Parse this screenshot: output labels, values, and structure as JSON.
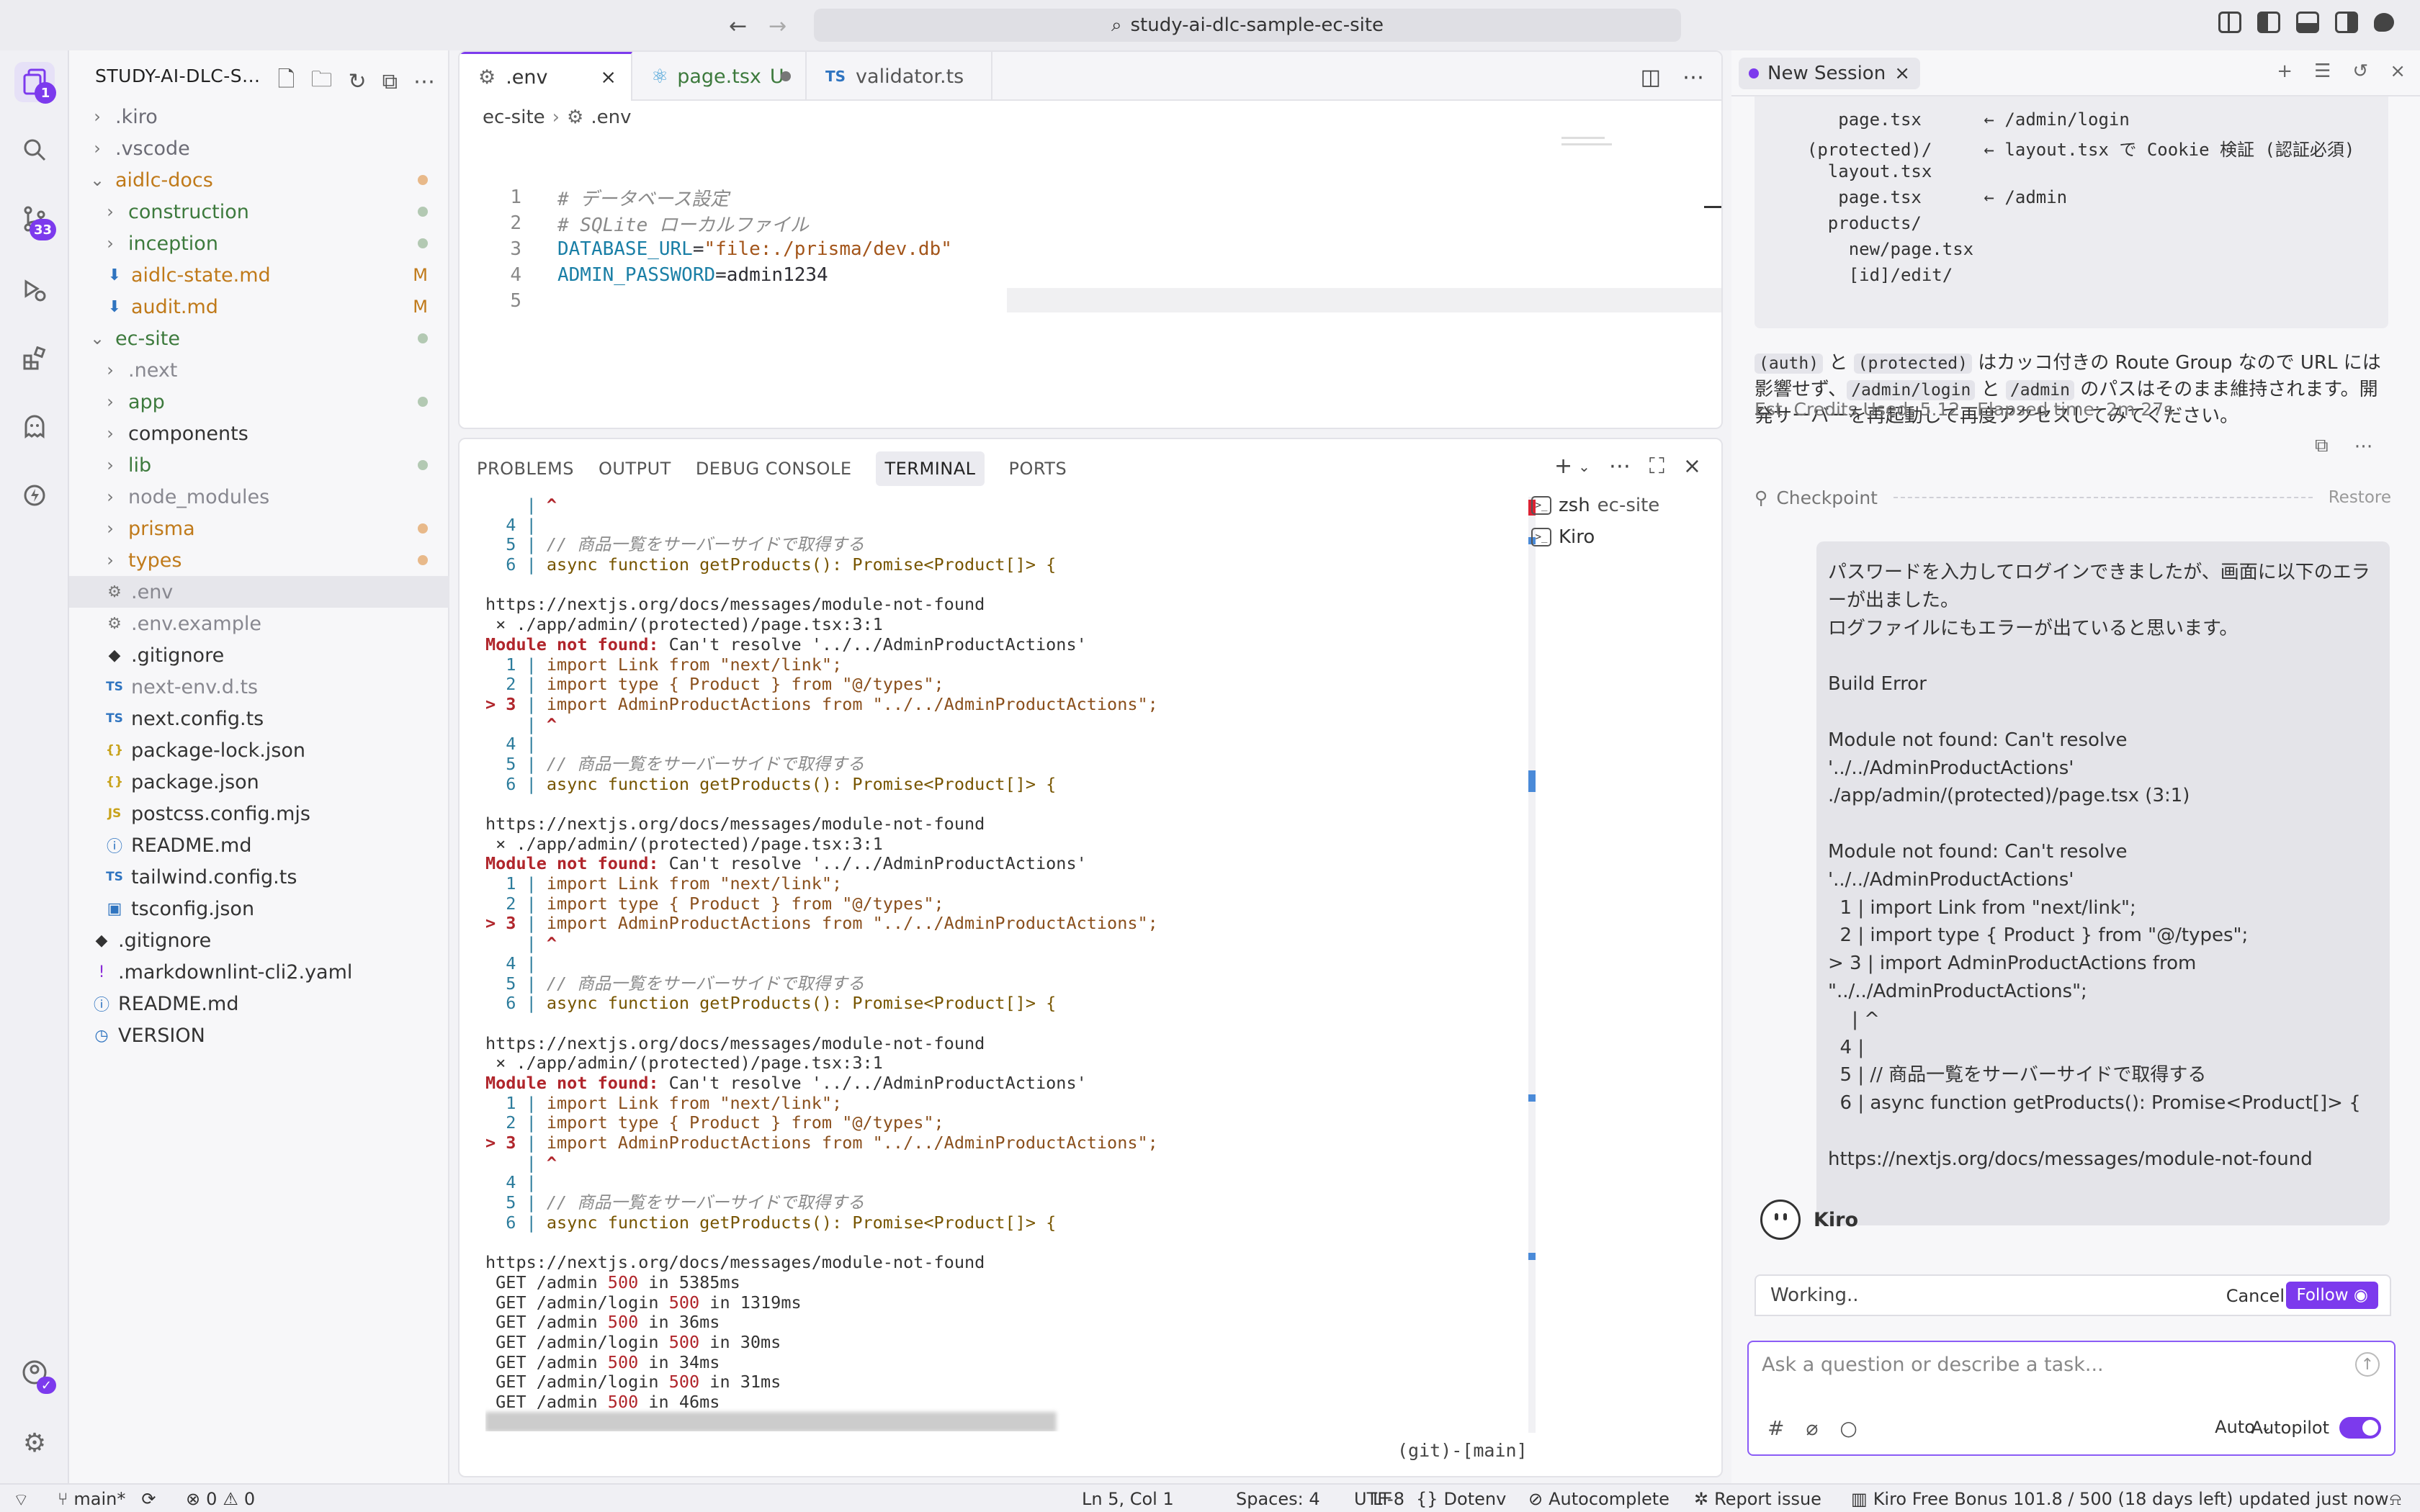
{
  "window": {
    "search": "study-ai-dlc-sample-ec-site"
  },
  "activity": {
    "explorer_badge": "1",
    "scm_badge": "33"
  },
  "explorer": {
    "title": "STUDY-AI-DLC-S...",
    "items": [
      {
        "label": ".kiro",
        "type": "folder",
        "depth": 0,
        "color": "#6b6b75"
      },
      {
        "label": ".vscode",
        "type": "folder",
        "depth": 0,
        "color": "#6b6b75"
      },
      {
        "label": "aidlc-docs",
        "type": "folder-open",
        "depth": 0,
        "color": "#c07a1a",
        "dot": "#e8b98a"
      },
      {
        "label": "construction",
        "type": "folder",
        "depth": 1,
        "color": "#3d7a3d",
        "dot": "#b3c9b3"
      },
      {
        "label": "inception",
        "type": "folder",
        "depth": 1,
        "color": "#3d7a3d",
        "dot": "#b3c9b3"
      },
      {
        "label": "aidlc-state.md",
        "type": "md",
        "depth": 1,
        "color": "#c07a1a",
        "mark": "M"
      },
      {
        "label": "audit.md",
        "type": "md",
        "depth": 1,
        "color": "#c07a1a",
        "mark": "M"
      },
      {
        "label": "ec-site",
        "type": "folder-open",
        "depth": 0,
        "color": "#3d7a3d",
        "dot": "#b3c9b3"
      },
      {
        "label": ".next",
        "type": "folder",
        "depth": 1,
        "color": "#888890"
      },
      {
        "label": "app",
        "type": "folder",
        "depth": 1,
        "color": "#3d7a3d",
        "dot": "#b3c9b3"
      },
      {
        "label": "components",
        "type": "folder",
        "depth": 1,
        "color": "#333"
      },
      {
        "label": "lib",
        "type": "folder",
        "depth": 1,
        "color": "#3d7a3d",
        "dot": "#b3c9b3"
      },
      {
        "label": "node_modules",
        "type": "folder",
        "depth": 1,
        "color": "#888890"
      },
      {
        "label": "prisma",
        "type": "folder",
        "depth": 1,
        "color": "#c07a1a",
        "dot": "#e8b98a"
      },
      {
        "label": "types",
        "type": "folder",
        "depth": 1,
        "color": "#c07a1a",
        "dot": "#e8b98a"
      },
      {
        "label": ".env",
        "type": "gear",
        "depth": 1,
        "color": "#888890",
        "selected": true
      },
      {
        "label": ".env.example",
        "type": "gear",
        "depth": 1,
        "color": "#888890"
      },
      {
        "label": ".gitignore",
        "type": "git",
        "depth": 1,
        "color": "#333"
      },
      {
        "label": "next-env.d.ts",
        "type": "ts",
        "depth": 1,
        "color": "#888890"
      },
      {
        "label": "next.config.ts",
        "type": "ts",
        "depth": 1,
        "color": "#333"
      },
      {
        "label": "package-lock.json",
        "type": "json",
        "depth": 1,
        "color": "#333"
      },
      {
        "label": "package.json",
        "type": "json",
        "depth": 1,
        "color": "#333"
      },
      {
        "label": "postcss.config.mjs",
        "type": "js",
        "depth": 1,
        "color": "#333"
      },
      {
        "label": "README.md",
        "type": "info",
        "depth": 1,
        "color": "#333"
      },
      {
        "label": "tailwind.config.ts",
        "type": "ts",
        "depth": 1,
        "color": "#333"
      },
      {
        "label": "tsconfig.json",
        "type": "tsj",
        "depth": 1,
        "color": "#333"
      },
      {
        "label": ".gitignore",
        "type": "git",
        "depth": 0,
        "color": "#333"
      },
      {
        "label": ".markdownlint-cli2.yaml",
        "type": "yaml",
        "depth": 0,
        "color": "#333"
      },
      {
        "label": "README.md",
        "type": "info",
        "depth": 0,
        "color": "#333"
      },
      {
        "label": "VERSION",
        "type": "clock",
        "depth": 0,
        "color": "#333"
      }
    ]
  },
  "editor": {
    "tabs": [
      {
        "label": ".env",
        "icon": "gear",
        "active": true,
        "suffix": "×"
      },
      {
        "label": "page.tsx",
        "icon": "react",
        "active": false,
        "suffix": "U"
      },
      {
        "label": "validator.ts",
        "icon": "ts",
        "active": false,
        "suffix": ""
      }
    ],
    "breadcrumb": {
      "folder": "ec-site",
      "file": ".env"
    },
    "lines": [
      {
        "n": "1",
        "parts": [
          {
            "t": "# データベース設定",
            "c": "comment"
          }
        ]
      },
      {
        "n": "2",
        "parts": [
          {
            "t": "# SQLite ローカルファイル",
            "c": "comment"
          }
        ]
      },
      {
        "n": "3",
        "parts": [
          {
            "t": "DATABASE_URL",
            "c": "key"
          },
          {
            "t": "=",
            "c": ""
          },
          {
            "t": "\"file:./prisma/dev.db\"",
            "c": "str"
          }
        ]
      },
      {
        "n": "4",
        "parts": [
          {
            "t": "ADMIN_PASSWORD",
            "c": "key"
          },
          {
            "t": "=admin1234",
            "c": ""
          }
        ]
      },
      {
        "n": "5",
        "parts": []
      }
    ]
  },
  "panel": {
    "tabs": [
      "PROBLEMS",
      "OUTPUT",
      "DEBUG CONSOLE",
      "TERMINAL",
      "PORTS"
    ],
    "active_tab": "TERMINAL",
    "terminals": [
      {
        "name": "zsh",
        "cwd": "ec-site"
      },
      {
        "name": "Kiro",
        "cwd": ""
      }
    ],
    "prompt_right": "(git)-[main]",
    "url": "https://nextjs.org/docs/messages/module-not-found",
    "file": " × ./app/admin/(protected)/page.tsx:3:1",
    "err_label": "Module not found:",
    "err_msg": " Can't resolve '../../AdminProductActions'",
    "import1": "import Link from \"next/link\";",
    "import2": "import type { Product } from \"@/types\";",
    "import3": "import AdminProductActions from \"../../AdminProductActions\";",
    "comment": "// 商品一覧をサーバーサイドで取得する",
    "fn": "async function getProducts(): Promise<Product[]> {",
    "caret": "^",
    "requests": [
      {
        "path": "/admin",
        "status": "500",
        "time": "in 5385ms"
      },
      {
        "path": "/admin/login",
        "status": "500",
        "time": "in 1319ms"
      },
      {
        "path": "/admin",
        "status": "500",
        "time": "in 36ms"
      },
      {
        "path": "/admin/login",
        "status": "500",
        "time": "in 30ms"
      },
      {
        "path": "/admin",
        "status": "500",
        "time": "in 34ms"
      },
      {
        "path": "/admin/login",
        "status": "500",
        "time": "in 31ms"
      },
      {
        "path": "/admin",
        "status": "500",
        "time": "in 46ms"
      }
    ]
  },
  "chat": {
    "session_tab": "New Session",
    "tree": [
      {
        "text": "     page.tsx      ← /admin/login",
        "kw": ""
      },
      {
        "text": "  (protected)/     ← layout.tsx で Cookie 検証 (認証必須)",
        "kw": ""
      },
      {
        "text": "    layout.tsx",
        "kw": ""
      },
      {
        "text": "     page.tsx      ← /admin",
        "kw": ""
      },
      {
        "text": "    products/",
        "kw": ""
      },
      {
        "text": "      new/page.tsx",
        "kw": ""
      },
      {
        "text": "      [id]/edit/",
        "kw": ""
      }
    ],
    "explain": {
      "c1": "(auth)",
      "t1": " と ",
      "c2": "(protected)",
      "t2": " はカッコ付きの Route Group なので URL には影響せず、",
      "c3": "/admin/login",
      "t3": " と ",
      "c4": "/admin",
      "t4": " のパスはそのまま維持されます。開発サーバーを再起動して再度アクセスしてみてください。"
    },
    "credits": "Est. Credits Used: 5.12   Elapsed time: 2m 27s",
    "checkpoint": "Checkpoint",
    "restore": "Restore",
    "user_message": "パスワードを入力してログインできましたが、画面に以下のエラーが出ました。\nログファイルにもエラーが出ていると思います。\n\nBuild Error\n\nModule not found: Can't resolve '../../AdminProductActions'\n./app/admin/(protected)/page.tsx (3:1)\n\nModule not found: Can't resolve '../../AdminProductActions'\n  1 | import Link from \"next/link\";\n  2 | import type { Product } from \"@/types\";\n> 3 | import AdminProductActions from\n\"../../AdminProductActions\";\n    | ^\n  4 |\n  5 | // 商品一覧をサーバーサイドで取得する\n  6 | async function getProducts(): Promise<Product[]> {\n\nhttps://nextjs.org/docs/messages/module-not-found",
    "agent_name": "Kiro",
    "working": "Working..",
    "cancel": "Cancel",
    "follow": "Follow",
    "input_placeholder": "Ask a question or describe a task...",
    "model": "Auto",
    "autopilot": "Autopilot"
  },
  "status": {
    "branch": "main*",
    "errors": "0",
    "warnings": "0",
    "position": "Ln 5, Col 1",
    "spaces": "Spaces: 4",
    "encoding": "UTF-8",
    "eol": "LF",
    "language": "Dotenv",
    "autocomplete": "Autocomplete",
    "report": "Report issue",
    "bonus": "Kiro Free Bonus 101.8 / 500 (18 days left) updated just now"
  },
  "colors": {
    "accent": "#7c3aed"
  }
}
